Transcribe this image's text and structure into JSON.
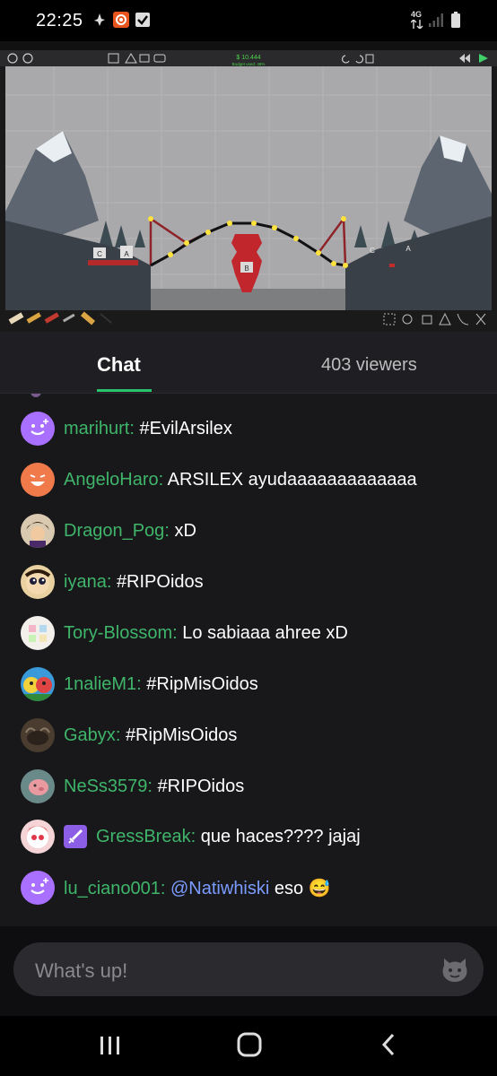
{
  "status_bar": {
    "time": "22:25",
    "network": "4G"
  },
  "video": {
    "stat_top": "$ 10.444",
    "stat_sub": "Budget used: 48%"
  },
  "chat_header": {
    "tab_label": "Chat",
    "viewers_label": "403 viewers",
    "accent_color": "#27c46b"
  },
  "messages": [
    {
      "user": "marihurt",
      "text": "#EvilArsilex",
      "avatar": "purple-smile"
    },
    {
      "user": "AngeloHaro",
      "text": "ARSILEX ayudaaaaaaaaaaaaa",
      "avatar": "orange-smile"
    },
    {
      "user": "Dragon_Pog",
      "text": "xD",
      "avatar": "anime-character"
    },
    {
      "user": "iyana",
      "text": "#RIPOidos",
      "avatar": "cartoon-face"
    },
    {
      "user": "Tory-Blossom",
      "text": "Lo sabiaaa ahree xD",
      "avatar": "pastel-pattern"
    },
    {
      "user": "1nalieM1",
      "text": "#RipMisOidos",
      "avatar": "cartoon-colorful"
    },
    {
      "user": "Gabyx",
      "text": "#RipMisOidos",
      "avatar": "dark-photo"
    },
    {
      "user": "NeSs3579",
      "text": "#RIPOidos",
      "avatar": "pink-photo"
    },
    {
      "user": "GressBreak",
      "text": "que haces???? jajaj",
      "avatar": "red-cartoon",
      "badge": "sword-badge"
    },
    {
      "user": "lu_ciano001",
      "mention": "@Natiwhiski",
      "text": "eso 😅",
      "avatar": "purple-smile"
    }
  ],
  "input": {
    "placeholder": "What's up!"
  }
}
